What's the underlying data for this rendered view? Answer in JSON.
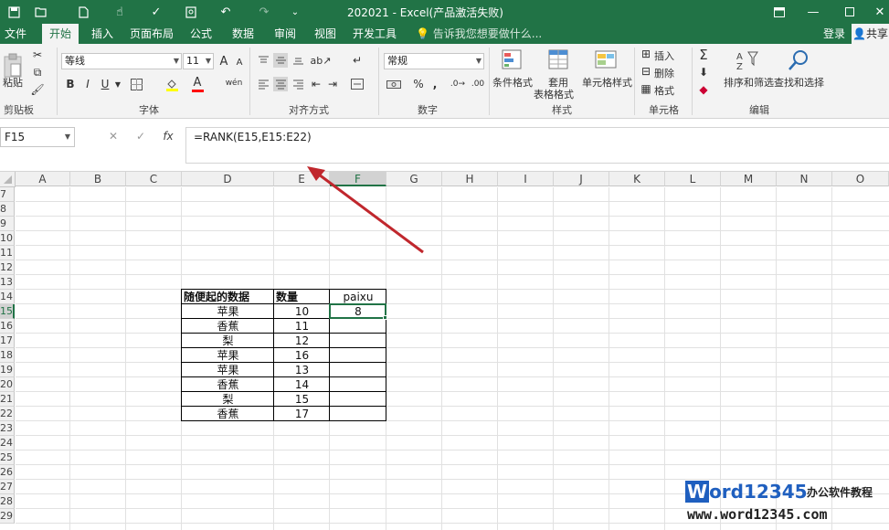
{
  "titlebar": {
    "title": "202021 - Excel(产品激活失败)",
    "bg_color": "#217346"
  },
  "tabs": [
    {
      "label": "文件"
    },
    {
      "label": "开始"
    },
    {
      "label": "插入"
    },
    {
      "label": "页面布局"
    },
    {
      "label": "公式"
    },
    {
      "label": "数据"
    },
    {
      "label": "审阅"
    },
    {
      "label": "视图"
    },
    {
      "label": "开发工具"
    }
  ],
  "tell_me": "告诉我您想要做什么...",
  "account": {
    "login": "登录",
    "share": "共享"
  },
  "ribbon": {
    "clipboard": {
      "paste": "粘贴",
      "label": "剪贴板"
    },
    "font": {
      "name": "等线",
      "size": "11",
      "bold": "B",
      "italic": "I",
      "underline": "U",
      "label": "字体",
      "grow": "A",
      "shrink": "A",
      "color_a": "A",
      "wen": "wén"
    },
    "align": {
      "label": "对齐方式"
    },
    "number": {
      "format": "常规",
      "label": "数字",
      "percent": "%",
      "comma": ","
    },
    "styles": {
      "cond_format": "条件格式",
      "table_format_1": "套用",
      "table_format_2": "表格格式",
      "cell_style": "单元格样式",
      "label": "样式"
    },
    "cells": {
      "insert": "插入",
      "delete": "删除",
      "format": "格式",
      "label": "单元格"
    },
    "editing": {
      "sort_filter": "排序和筛选",
      "find_select": "查找和选择",
      "label": "编辑"
    }
  },
  "formula_bar": {
    "name_box": "F15",
    "formula": "=RANK(E15,E15:E22)",
    "fx": "fx"
  },
  "columns": [
    "A",
    "B",
    "C",
    "D",
    "E",
    "F",
    "G",
    "H",
    "I",
    "J",
    "K",
    "L",
    "M",
    "N",
    "O"
  ],
  "rows": [
    "7",
    "8",
    "9",
    "10",
    "11",
    "12",
    "13",
    "14",
    "15",
    "16",
    "17",
    "18",
    "19",
    "20",
    "21",
    "22",
    "23",
    "24",
    "25",
    "26",
    "27",
    "28",
    "29"
  ],
  "table": {
    "headers": [
      "随便起的数据",
      "数量",
      "paixu"
    ],
    "rows": [
      [
        "苹果",
        "10",
        "8"
      ],
      [
        "香蕉",
        "11",
        ""
      ],
      [
        "梨",
        "12",
        ""
      ],
      [
        "苹果",
        "16",
        ""
      ],
      [
        "苹果",
        "13",
        ""
      ],
      [
        "香蕉",
        "14",
        ""
      ],
      [
        "梨",
        "15",
        ""
      ],
      [
        "香蕉",
        "17",
        ""
      ]
    ]
  },
  "watermark": {
    "brand": "Word12345",
    "slogan": "办公软件教程",
    "url": "www.word12345.com"
  },
  "colors": {
    "accent": "#217346",
    "arrow": "#c0272d"
  }
}
